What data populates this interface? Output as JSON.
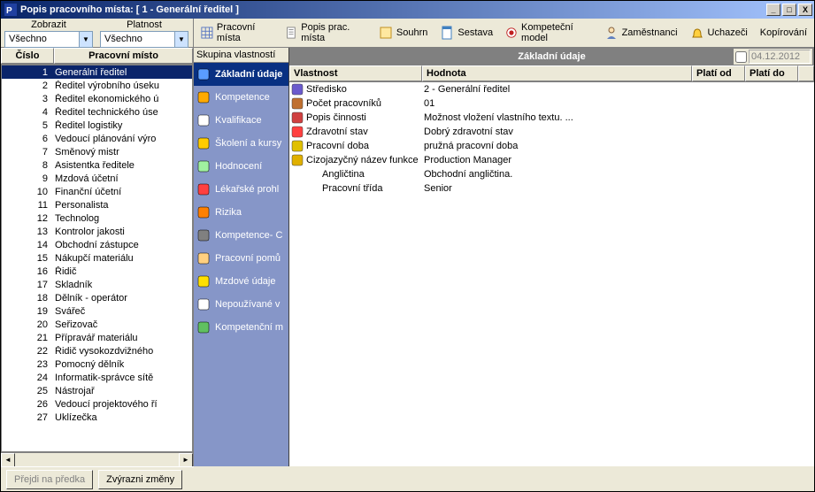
{
  "window": {
    "title": "Popis pracovního místa: [ 1 - Generální ředitel ]"
  },
  "upper": {
    "zobrazit_label": "Zobrazit",
    "zobrazit_value": "Všechno",
    "platnost_label": "Platnost",
    "platnost_value": "Všechno"
  },
  "toolbar": {
    "pracovni_mista": "Pracovní místa",
    "popis_prac_mista": "Popis prac. místa",
    "souhrn": "Souhrn",
    "sestava": "Sestava",
    "kompetencni_model": "Kompeteční model",
    "zamestnanci": "Zaměstnanci",
    "uchazeci": "Uchazeči",
    "kopirovani": "Kopírování"
  },
  "list": {
    "col_num": "Číslo",
    "col_pos": "Pracovní místo",
    "rows": [
      {
        "n": "1",
        "p": "Generální ředitel",
        "sel": true
      },
      {
        "n": "2",
        "p": "Ředitel výrobního úseku"
      },
      {
        "n": "3",
        "p": "Ředitel ekonomického ú"
      },
      {
        "n": "4",
        "p": "Ředitel technického úse"
      },
      {
        "n": "5",
        "p": "Ředitel logistiky"
      },
      {
        "n": "6",
        "p": "Vedoucí plánování výro"
      },
      {
        "n": "7",
        "p": "Směnový mistr"
      },
      {
        "n": "8",
        "p": "Asistentka ředitele"
      },
      {
        "n": "9",
        "p": "Mzdová účetní"
      },
      {
        "n": "10",
        "p": "Finanční účetní"
      },
      {
        "n": "11",
        "p": "Personalista"
      },
      {
        "n": "12",
        "p": "Technolog"
      },
      {
        "n": "13",
        "p": "Kontrolor jakosti"
      },
      {
        "n": "14",
        "p": "Obchodní zástupce"
      },
      {
        "n": "15",
        "p": "Nákupčí materiálu"
      },
      {
        "n": "16",
        "p": "Řidič"
      },
      {
        "n": "17",
        "p": "Skladník"
      },
      {
        "n": "18",
        "p": "Dělník - operátor"
      },
      {
        "n": "19",
        "p": "Svářeč"
      },
      {
        "n": "20",
        "p": "Seřizovač"
      },
      {
        "n": "21",
        "p": "Přípravář materiálu"
      },
      {
        "n": "22",
        "p": "Řidič vysokozdvižného"
      },
      {
        "n": "23",
        "p": "Pomocný dělník"
      },
      {
        "n": "24",
        "p": "Informatik-správce sítě"
      },
      {
        "n": "25",
        "p": "Nástrojař"
      },
      {
        "n": "26",
        "p": "Vedoucí projektového ří"
      },
      {
        "n": "27",
        "p": "Uklízečka"
      }
    ]
  },
  "groups": {
    "header": "Skupina vlastností",
    "items": [
      {
        "label": "Základní údaje",
        "sel": true,
        "color": "#5a9dff"
      },
      {
        "label": "Kompetence",
        "color": "#ffaa00"
      },
      {
        "label": "Kvalifikace",
        "color": "#ffffff"
      },
      {
        "label": "Školení a kursy",
        "color": "#ffcc00"
      },
      {
        "label": "Hodnocení",
        "color": "#a0f0a0"
      },
      {
        "label": "Lékařské prohl",
        "color": "#ff4040"
      },
      {
        "label": "Rizika",
        "color": "#ff8000"
      },
      {
        "label": "Kompetence- C",
        "color": "#808080"
      },
      {
        "label": "Pracovní pomů",
        "color": "#ffd080"
      },
      {
        "label": "Mzdové údaje",
        "color": "#ffe000"
      },
      {
        "label": "Nepoužívané v",
        "color": "#ffffff"
      },
      {
        "label": "Kompetenční m",
        "color": "#60c060"
      }
    ]
  },
  "detail": {
    "title": "Základní údaje",
    "date": "04.12.2012",
    "cols": {
      "vlastnost": "Vlastnost",
      "hodnota": "Hodnota",
      "plati_od": "Platí od",
      "plati_do": "Platí do"
    },
    "rows": [
      {
        "icon": "#6a5acd",
        "label": "Středisko",
        "value": "2 - Generální ředitel"
      },
      {
        "icon": "#c07030",
        "label": "Počet pracovníků",
        "value": "01"
      },
      {
        "icon": "#d04040",
        "label": "Popis činnosti",
        "value": "Možnost vložení vlastního textu. ..."
      },
      {
        "icon": "#ff4040",
        "label": "Zdravotní stav",
        "value": "Dobrý zdravotní stav"
      },
      {
        "icon": "#e0c000",
        "label": "Pracovní doba",
        "value": "pružná pracovní doba"
      },
      {
        "icon": "#e0b000",
        "label": "Cizojazyčný název funkce",
        "value": "Production Manager"
      },
      {
        "icon": "",
        "label": "Angličtina",
        "value": "Obchodní angličtina.",
        "indent": true
      },
      {
        "icon": "",
        "label": "Pracovní třída",
        "value": "Senior",
        "indent": true
      }
    ]
  },
  "bottom": {
    "prejdi": "Přejdi na předka",
    "zvyrazni": "Zvýrazni změny"
  }
}
